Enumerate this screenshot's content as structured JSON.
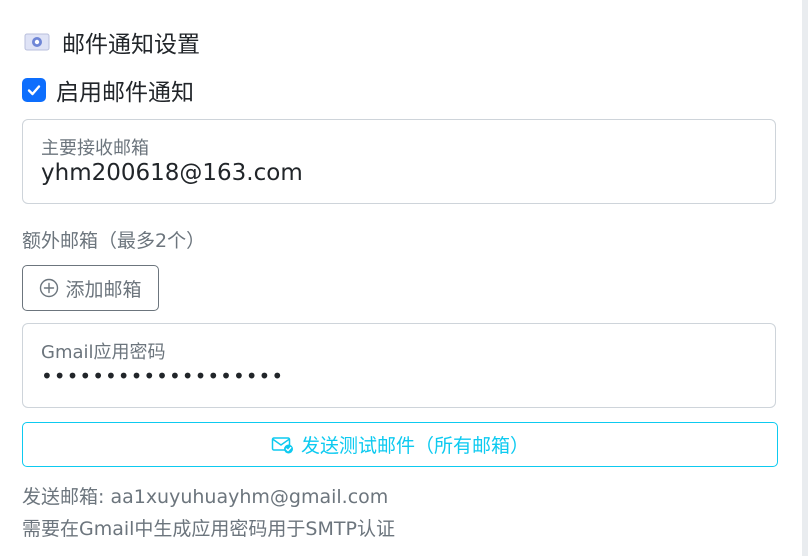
{
  "section": {
    "title": "邮件通知设置",
    "icon": "envelope-icon"
  },
  "enable": {
    "label": "启用邮件通知",
    "checked": true,
    "color": "#0d6efd"
  },
  "primary_email": {
    "label": "主要接收邮箱",
    "value": "yhm200618@163.com"
  },
  "extra_emails": {
    "label": "额外邮箱（最多2个）",
    "add_button": "添加邮箱",
    "add_icon": "plus-circle-icon"
  },
  "gmail_password": {
    "label": "Gmail应用密码",
    "value": "•••••••••••••••••••"
  },
  "test_button": {
    "label": "发送测试邮件（所有邮箱）",
    "icon": "envelope-check-icon",
    "color": "#0dcaf0"
  },
  "help": {
    "sender": "发送邮箱: aa1xuyuhuayhm@gmail.com",
    "note": "需要在Gmail中生成应用密码用于SMTP认证"
  }
}
